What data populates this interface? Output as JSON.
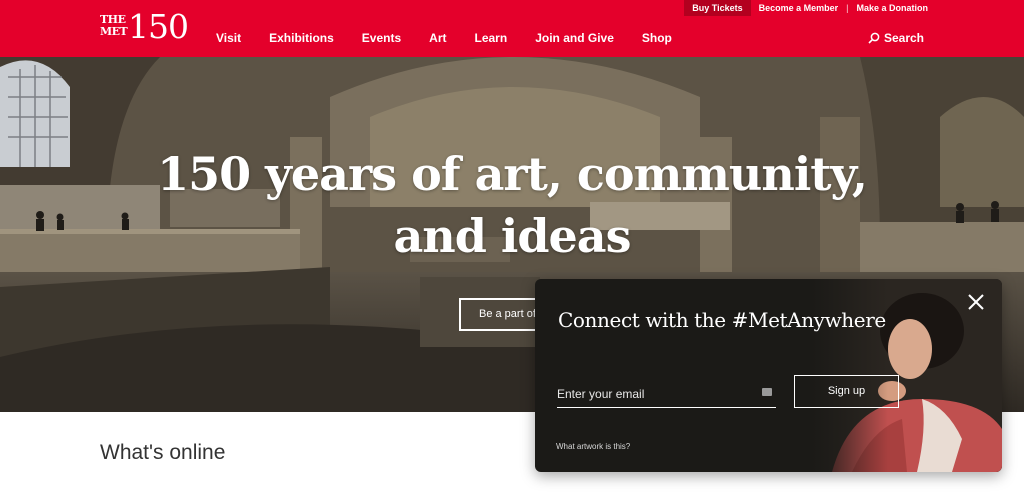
{
  "utility_nav": {
    "buy_tickets": "Buy Tickets",
    "become_member": "Become a Member",
    "separator": "|",
    "donation": "Make a Donation"
  },
  "logo": {
    "line1": "THE",
    "line2": "MET",
    "number": "150"
  },
  "nav": {
    "items": [
      "Visit",
      "Exhibitions",
      "Events",
      "Art",
      "Learn",
      "Join and Give",
      "Shop"
    ],
    "search_label": "Search",
    "search_icon": "search-icon"
  },
  "hero": {
    "title_line1": "150 years of art, community,",
    "title_line2": "and ideas",
    "cta_label": "Be a part of"
  },
  "section": {
    "heading": "What's online"
  },
  "popup": {
    "title": "Connect with the #MetAnywhere",
    "email_placeholder": "Enter your email",
    "signup_label": "Sign up",
    "artwork_link": "What artwork is this?",
    "close_icon": "close-icon"
  },
  "colors": {
    "brand_red": "#e4002b",
    "popup_bg": "#1b1a17",
    "white": "#ffffff"
  }
}
